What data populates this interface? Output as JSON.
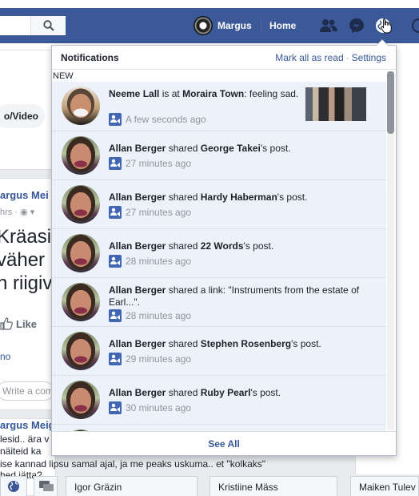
{
  "header": {
    "profile_name": "Margus",
    "home_label": "Home",
    "icons": [
      "search-icon",
      "friend-requests-icon",
      "messenger-icon",
      "notifications-globe-icon",
      "hand-cursor-icon"
    ]
  },
  "colors": {
    "brand_blue": "#3b5998",
    "link_blue": "#365899",
    "unread_bg": "#edf2fa"
  },
  "notifications": {
    "title": "Notifications",
    "mark_all_read": "Mark all as read",
    "separator": "·",
    "settings": "Settings",
    "new_label": "NEW",
    "see_all": "See All",
    "items": [
      {
        "actor": "Neeme Lall",
        "pre": "is at",
        "object": "Moraira Town",
        "post": ": feeling sad.",
        "time": "A few seconds ago"
      },
      {
        "actor": "Allan Berger",
        "pre": "shared",
        "object": "George Takei",
        "post": "'s post.",
        "time": "27 minutes ago"
      },
      {
        "actor": "Allan Berger",
        "pre": "shared",
        "object": "Hardy Haberman",
        "post": "'s post.",
        "time": "27 minutes ago"
      },
      {
        "actor": "Allan Berger",
        "pre": "shared",
        "object": "22 Words",
        "post": "'s post.",
        "time": "28 minutes ago"
      },
      {
        "actor": "Allan Berger",
        "pre": "shared a link: \"Instruments from the estate of Earl...\".",
        "object": "",
        "post": "",
        "time": "28 minutes ago"
      },
      {
        "actor": "Allan Berger",
        "pre": "shared",
        "object": "Stephen Rosenberg",
        "post": "'s post.",
        "time": "29 minutes ago"
      },
      {
        "actor": "Allan Berger",
        "pre": "shared",
        "object": "Ruby Pearl",
        "post": "'s post.",
        "time": "30 minutes ago"
      }
    ]
  },
  "feed": {
    "photo_video": "o/Video",
    "post_author": "argus Mei",
    "post_time": "hrs ·",
    "big_lines": [
      "Kräasin",
      " väher",
      "n riigiva"
    ],
    "like": "Like",
    "see_no": "no",
    "comment_placeholder": "Write a comm",
    "second_author": "argus Meig",
    "second_lines": [
      "lesid.. ära v",
      "näiteid ka",
      " ise kannad lipsu samal ajal, ja me peaks uskuma.. et \"kolkaks\"",
      "hed jätta?"
    ]
  },
  "chat": {
    "tabs": [
      "Igor Gräzin",
      "Kristiine Mäss",
      "Maiken Tulev"
    ]
  }
}
